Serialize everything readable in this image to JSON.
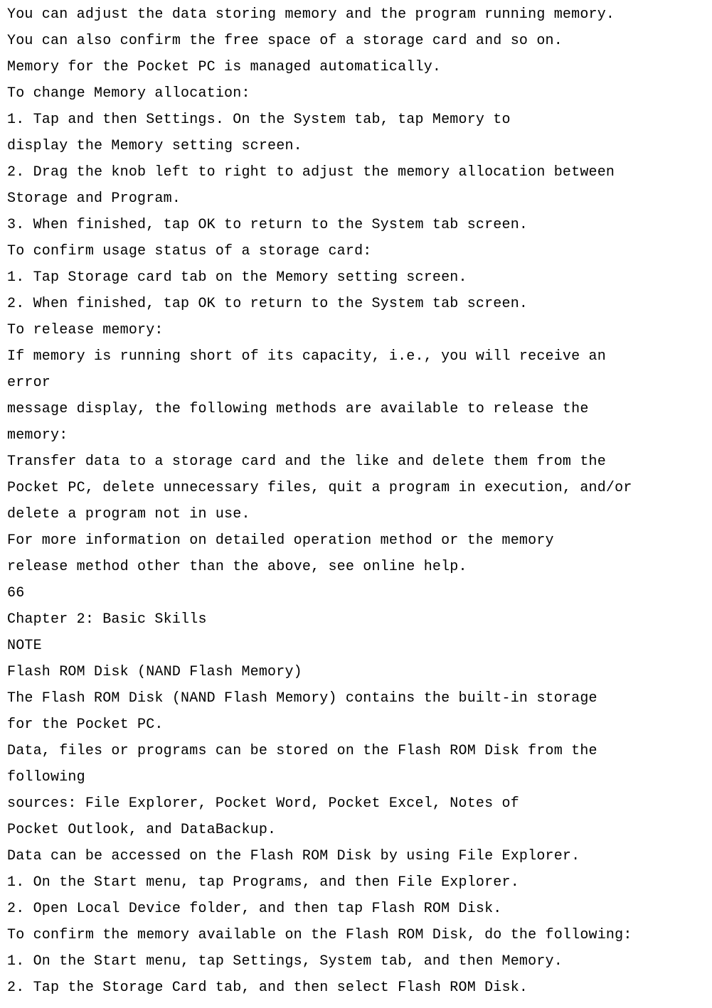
{
  "lines": [
    "You can adjust the data storing memory and the program running memory.",
    "You can also confirm the free space of a storage card and so on.",
    "Memory for the Pocket PC is managed automatically.",
    "To change Memory allocation:",
    "1. Tap and then Settings. On the System tab, tap Memory to",
    "display the Memory setting screen.",
    "2. Drag the knob left to right to adjust the memory allocation between",
    "Storage and Program.",
    "3. When finished, tap OK to return to the System tab screen.",
    "To confirm usage status of a storage card:",
    "1. Tap Storage card tab on the Memory setting screen.",
    "2. When finished, tap OK to return to the System tab screen.",
    "To release memory:",
    "If memory is running short of its capacity, i.e., you will receive an",
    "error",
    "message display, the following methods are available to release the",
    "memory:",
    "Transfer data to a storage card and the like and delete them from the",
    "Pocket PC, delete unnecessary files, quit a program in execution, and/or",
    "delete a program not in use.",
    "For more information on detailed operation method or the memory",
    "release method other than the above, see online help.",
    "66",
    "Chapter 2: Basic Skills",
    "NOTE",
    "Flash ROM Disk (NAND Flash Memory)",
    "The Flash ROM Disk (NAND Flash Memory) contains the built-in storage",
    "for the Pocket PC.",
    "Data, files or programs can be stored on the Flash ROM Disk from the",
    "following",
    "sources: File Explorer, Pocket Word, Pocket Excel, Notes of",
    "Pocket Outlook, and DataBackup.",
    "Data can be accessed on the Flash ROM Disk by using File Explorer.",
    "1. On the Start menu, tap Programs, and then File Explorer.",
    "2. Open Local Device folder, and then tap Flash ROM Disk.",
    "To confirm the memory available on the Flash ROM Disk, do the following:",
    "1. On the Start menu, tap Settings, System tab, and then Memory.",
    "2. Tap the Storage Card tab, and then select Flash ROM Disk."
  ]
}
